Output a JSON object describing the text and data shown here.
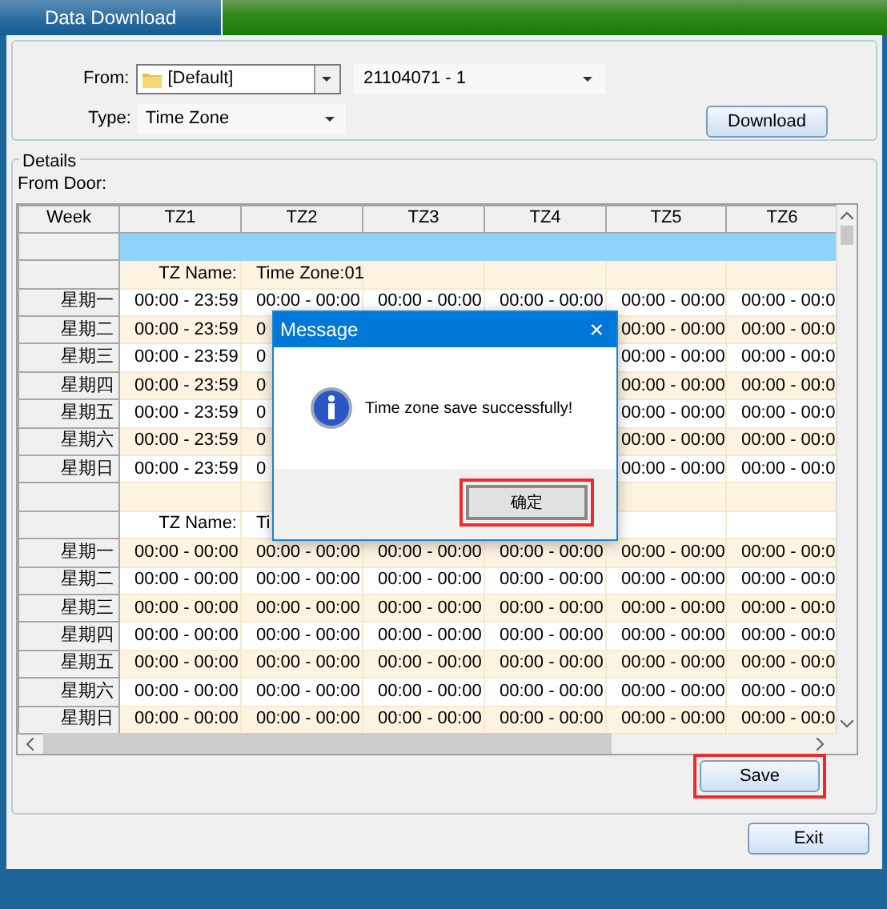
{
  "window": {
    "title": "Data Download"
  },
  "source": {
    "from_label": "From:",
    "from_value": "[Default]",
    "device_value": "21104071 - 1",
    "type_label": "Type:",
    "type_value": "Time Zone",
    "download_button": "Download"
  },
  "details": {
    "legend": "Details",
    "from_door_label": "From Door:",
    "table": {
      "columns": [
        "Week",
        "TZ1",
        "TZ2",
        "TZ3",
        "TZ4",
        "TZ5",
        "TZ6"
      ],
      "rows": [
        {
          "kind": "blank",
          "selected": true
        },
        {
          "kind": "name",
          "selected": false,
          "cells": [
            null,
            "TZ Name:",
            "Time Zone:01",
            null,
            null,
            null,
            null
          ]
        },
        {
          "kind": "day",
          "selected": false,
          "cells": [
            "星期一",
            "00:00 - 23:59",
            "00:00 - 00:00",
            "00:00 - 00:00",
            "00:00 - 00:00",
            "00:00 - 00:00",
            "00:00 - 00:0"
          ]
        },
        {
          "kind": "day",
          "selected": false,
          "cells": [
            "星期二",
            "00:00 - 23:59",
            "0",
            null,
            null,
            "00:00 - 00:00",
            "00:00 - 00:0"
          ]
        },
        {
          "kind": "day",
          "selected": false,
          "cells": [
            "星期三",
            "00:00 - 23:59",
            "0",
            null,
            null,
            "00:00 - 00:00",
            "00:00 - 00:0"
          ]
        },
        {
          "kind": "day",
          "selected": false,
          "cells": [
            "星期四",
            "00:00 - 23:59",
            "0",
            null,
            null,
            "00:00 - 00:00",
            "00:00 - 00:0"
          ]
        },
        {
          "kind": "day",
          "selected": false,
          "cells": [
            "星期五",
            "00:00 - 23:59",
            "0",
            null,
            null,
            "00:00 - 00:00",
            "00:00 - 00:0"
          ]
        },
        {
          "kind": "day",
          "selected": false,
          "cells": [
            "星期六",
            "00:00 - 23:59",
            "0",
            null,
            null,
            "00:00 - 00:00",
            "00:00 - 00:0"
          ]
        },
        {
          "kind": "day",
          "selected": false,
          "cells": [
            "星期日",
            "00:00 - 23:59",
            "0",
            null,
            null,
            "00:00 - 00:00",
            "00:00 - 00:0"
          ]
        },
        {
          "kind": "blank",
          "selected": false
        },
        {
          "kind": "name",
          "selected": false,
          "cells": [
            null,
            "TZ Name:",
            "Ti",
            null,
            null,
            null,
            null
          ]
        },
        {
          "kind": "day",
          "selected": false,
          "cells": [
            "星期一",
            "00:00 - 00:00",
            "00:00 - 00:00",
            "00:00 - 00:00",
            "00:00 - 00:00",
            "00:00 - 00:00",
            "00:00 - 00:0"
          ]
        },
        {
          "kind": "day",
          "selected": false,
          "cells": [
            "星期二",
            "00:00 - 00:00",
            "00:00 - 00:00",
            "00:00 - 00:00",
            "00:00 - 00:00",
            "00:00 - 00:00",
            "00:00 - 00:0"
          ]
        },
        {
          "kind": "day",
          "selected": false,
          "cells": [
            "星期三",
            "00:00 - 00:00",
            "00:00 - 00:00",
            "00:00 - 00:00",
            "00:00 - 00:00",
            "00:00 - 00:00",
            "00:00 - 00:0"
          ]
        },
        {
          "kind": "day",
          "selected": false,
          "cells": [
            "星期四",
            "00:00 - 00:00",
            "00:00 - 00:00",
            "00:00 - 00:00",
            "00:00 - 00:00",
            "00:00 - 00:00",
            "00:00 - 00:0"
          ]
        },
        {
          "kind": "day",
          "selected": false,
          "cells": [
            "星期五",
            "00:00 - 00:00",
            "00:00 - 00:00",
            "00:00 - 00:00",
            "00:00 - 00:00",
            "00:00 - 00:00",
            "00:00 - 00:0"
          ]
        },
        {
          "kind": "day",
          "selected": false,
          "cells": [
            "星期六",
            "00:00 - 00:00",
            "00:00 - 00:00",
            "00:00 - 00:00",
            "00:00 - 00:00",
            "00:00 - 00:00",
            "00:00 - 00:0"
          ]
        },
        {
          "kind": "day",
          "selected": false,
          "cells": [
            "星期日",
            "00:00 - 00:00",
            "00:00 - 00:00",
            "00:00 - 00:00",
            "00:00 - 00:00",
            "00:00 - 00:00",
            "00:00 - 00:0"
          ]
        }
      ]
    }
  },
  "save_button": {
    "label": "Save",
    "highlighted": true
  },
  "exit_button": {
    "label": "Exit",
    "highlighted": false
  },
  "dialog": {
    "title": "Message",
    "close": "×",
    "message": "Time zone save successfully!",
    "ok_button": {
      "label": "确定",
      "highlighted": true
    }
  }
}
